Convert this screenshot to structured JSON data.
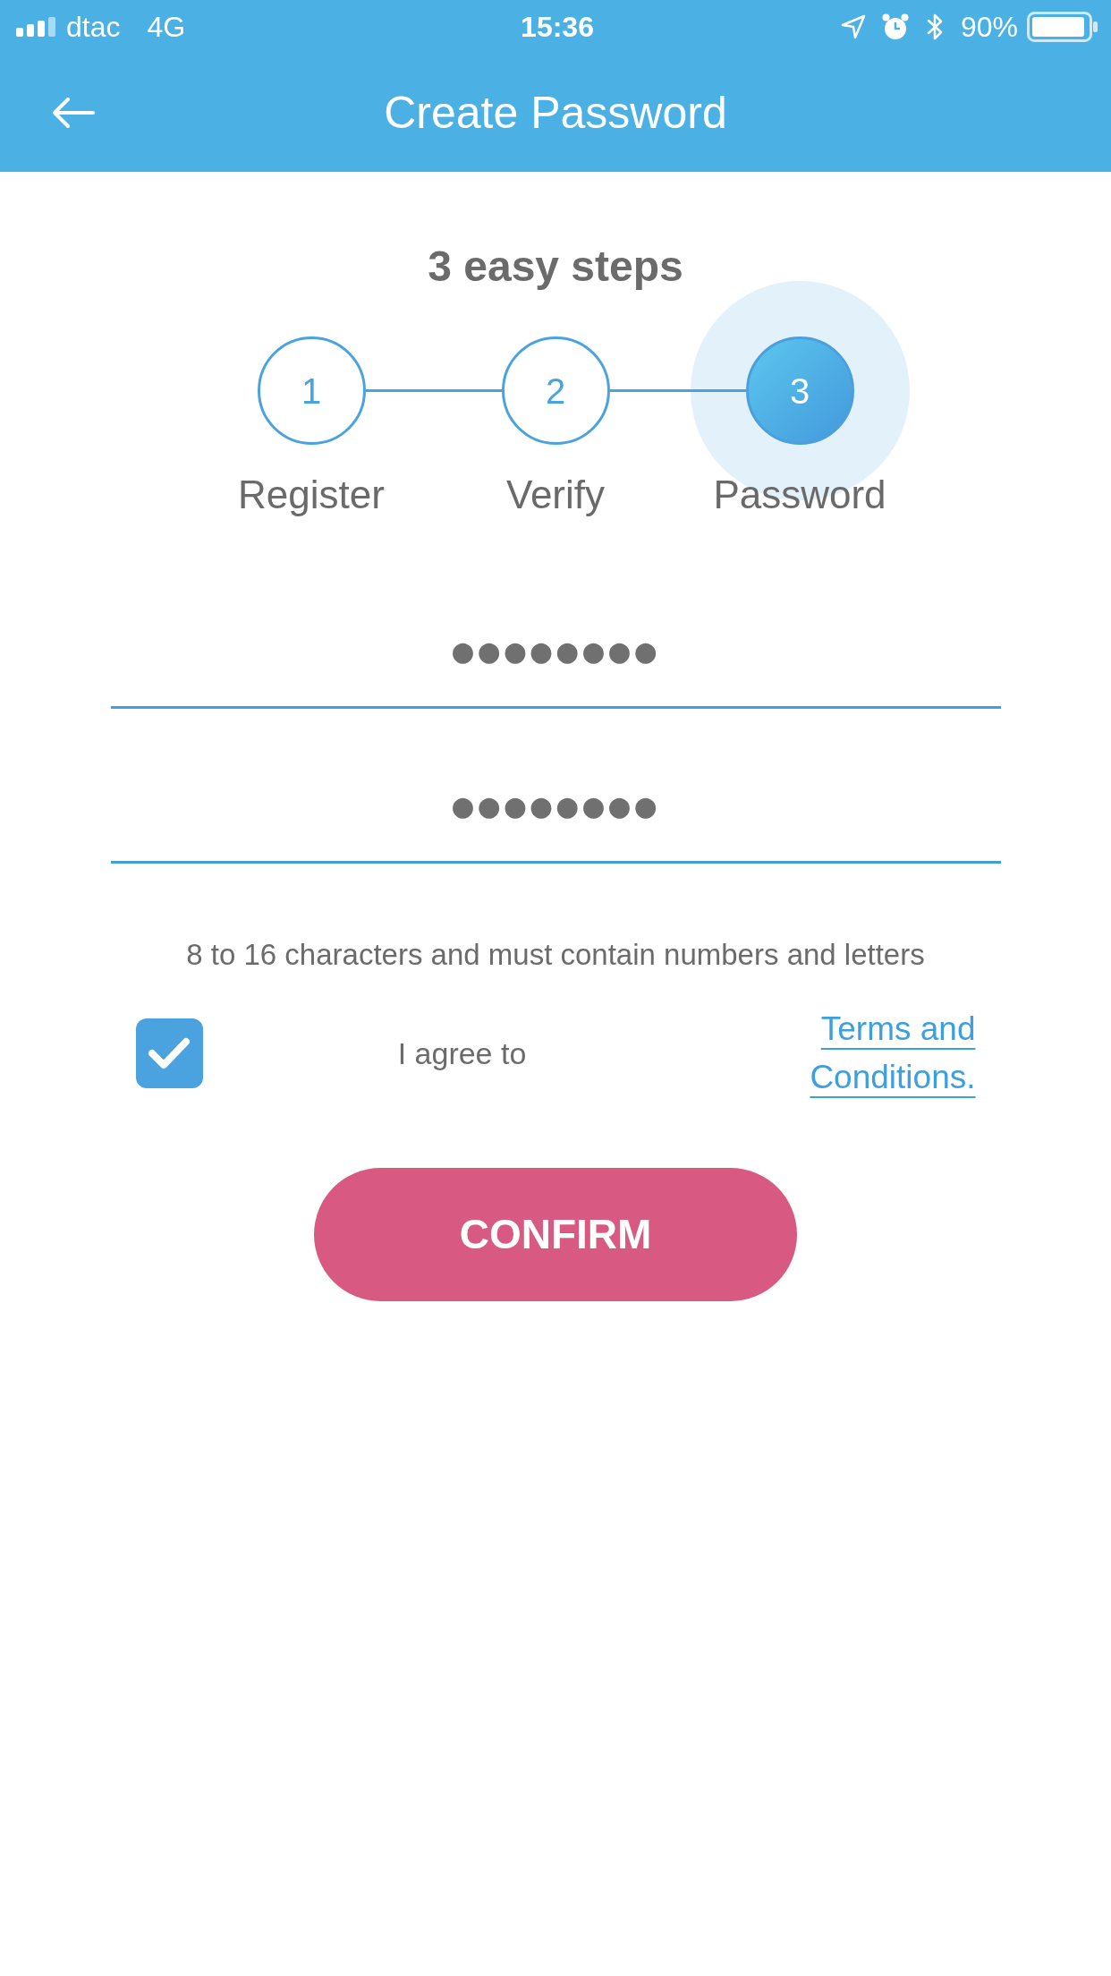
{
  "status_bar": {
    "carrier": "dtac",
    "network": "4G",
    "time": "15:36",
    "battery": "90%"
  },
  "header": {
    "title": "Create Password"
  },
  "steps": {
    "title": "3 easy steps",
    "items": [
      {
        "number": "1",
        "label": "Register",
        "selected": false
      },
      {
        "number": "2",
        "label": "Verify",
        "selected": false
      },
      {
        "number": "3",
        "label": "Password",
        "selected": true
      }
    ]
  },
  "password_fields": [
    {
      "value": "●●●●●●●●"
    },
    {
      "value": "●●●●●●●●"
    }
  ],
  "hint": "8 to 16 characters and must contain numbers and letters",
  "agreement": {
    "checked": true,
    "label": "I agree to",
    "link": "Terms and Conditions."
  },
  "confirm_button": "CONFIRM"
}
